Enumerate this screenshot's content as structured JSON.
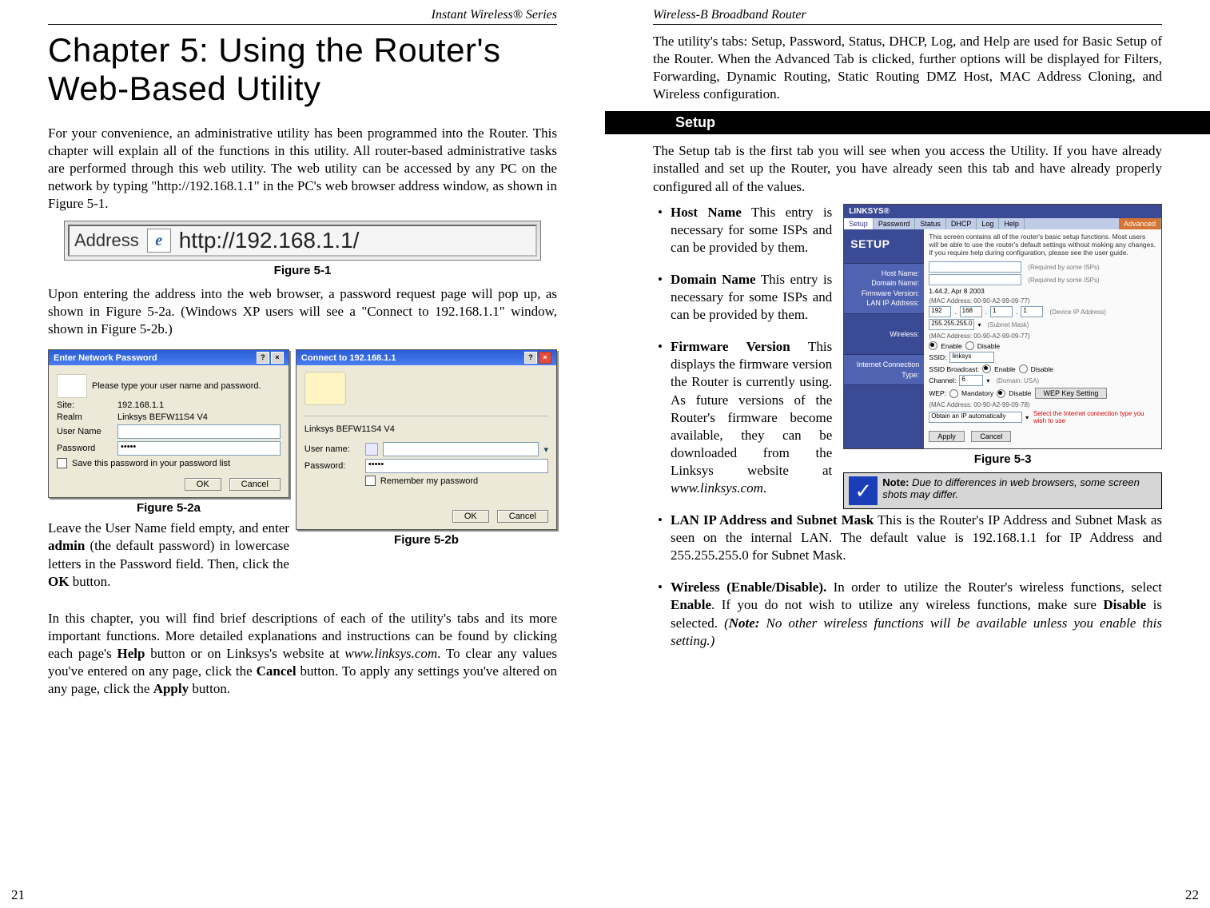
{
  "left": {
    "header": "Instant Wireless® Series",
    "chapter_title": "Chapter 5: Using the Router's Web-Based Utility",
    "p1": "For your convenience, an administrative utility has been programmed into the Router. This chapter will explain all of the functions in this utility. All router-based administrative tasks are performed through this web utility. The web utility can be accessed by any PC on the network by typing \"http://192.168.1.1\" in the PC's web browser address window, as shown in Figure 5-1.",
    "addr_label": "Address",
    "url": "http://192.168.1.1/",
    "fig1": "Figure 5-1",
    "p2": "Upon entering the address into the web browser, a password request page will pop up, as shown in Figure 5-2a. (Windows XP users will see a \"Connect to 192.168.1.1\" window, shown in Figure 5-2b.)",
    "dlgA": {
      "title": "Enter Network Password",
      "help": "?",
      "close": "×",
      "intro": "Please type your user name and password.",
      "site_lbl": "Site:",
      "site_val": "192.168.1.1",
      "realm_lbl": "Realm",
      "realm_val": "Linksys BEFW11S4 V4",
      "user_lbl": "User Name",
      "pass_lbl": "Password",
      "pass_val": "•••••",
      "save_chk": "Save this password in your password list",
      "ok": "OK",
      "cancel": "Cancel"
    },
    "fig2a": "Figure 5-2a",
    "dlgB": {
      "title": "Connect to 192.168.1.1",
      "help": "?",
      "close": "×",
      "realm": "Linksys BEFW11S4 V4",
      "user_lbl": "User name:",
      "pass_lbl": "Password:",
      "pass_val": "•••••",
      "rem": "Remember my password",
      "ok": "OK",
      "cancel": "Cancel"
    },
    "fig2b": "Figure 5-2b",
    "p3a": "Leave the User Name field empty, and enter ",
    "p3b": "admin",
    "p3c": " (the default password) in lowercase letters in the Password field.  Then, click the ",
    "p3d": "OK",
    "p3e": " button.",
    "p4": "In this chapter, you will find brief descriptions of each of the utility's tabs and its more important functions.  More detailed explanations and instructions can be found by clicking each page's Help button or on Linksys's website at www.linksys.com.  To clear any values you've entered on any page, click  the Cancel button.  To apply any settings you've altered on any page, click the Apply button.",
    "pagenum": "21"
  },
  "right": {
    "header": "Wireless-B Broadband Router",
    "p1": "The utility's tabs: Setup, Password, Status, DHCP, Log, and Help are used for Basic Setup of the Router. When the Advanced Tab is clicked, further options will be displayed for Filters, Forwarding, Dynamic Routing, Static Routing DMZ Host, MAC Address Cloning, and Wireless configuration.",
    "section": "Setup",
    "p2": "The Setup tab is the first tab you will see when you access the Utility. If you have already installed and set up the Router, you have already seen this tab and have already properly configured all of the values.",
    "bullets_narrow": [
      {
        "b": "Host Name",
        "t": "  This entry is necessary for some ISPs and can be provided by them."
      },
      {
        "b": "Domain Name",
        "t": "  This entry is necessary for some ISPs and can be provided by them."
      },
      {
        "b": "Firmware Version",
        "t": " This displays the firmware version the Router is currently using. As future versions of the Router's firmware become available, they can be downloaded from the Linksys website at www.linksys.com."
      }
    ],
    "fig3": "Figure 5-3",
    "note_label": "Note:",
    "note_text": "  Due to differences in web browsers, some screen shots may differ.",
    "router": {
      "brand": "LINKSYS®",
      "tabs": [
        "Setup",
        "Password",
        "Status",
        "DHCP",
        "Log",
        "Help"
      ],
      "adv": "Advanced",
      "side_title": "SETUP",
      "side_labels": [
        "Host Name:",
        "Domain Name:",
        "Firmware Version:",
        "LAN IP Address:"
      ],
      "side_wireless": "Wireless:",
      "side_ict": "Internet Connection Type:",
      "desc": "This screen contains all of the router's basic setup functions. Most users will be able to use the router's default settings without making any changes. If you require help during configuration, please see the user guide.",
      "req_hint": "(Required by some ISPs)",
      "fw": "1.44.2, Apr 8 2003",
      "mac1": "(MAC Address: 00-90-A2-99-09-77)",
      "ip": [
        "192",
        "168",
        "1",
        "1"
      ],
      "ip_hint": "(Device IP Address)",
      "mask": "255.255.255.0",
      "mask_hint": "(Subnet Mask)",
      "enable": "Enable",
      "disable": "Disable",
      "mac2": "(MAC Address: 00-90-A2-99-09-77)",
      "ssid_lbl": "SSID:",
      "ssid_val": "linksys",
      "ssidb_lbl": "SSID Broadcast:",
      "chan_lbl": "Channel:",
      "chan_val": "6",
      "chan_hint": "(Domain: USA)",
      "wep_lbl": "WEP:",
      "wep_mandatory": "Mandatory",
      "wep_btn": "WEP Key Setting",
      "mac3": "(MAC Address: 00-90-A2-99-09-78)",
      "ict_val": "Obtain an IP automatically",
      "ict_hint": "Select the Internet connection type you wish to use",
      "apply": "Apply",
      "cancel": "Cancel"
    },
    "bullets_wide": [
      {
        "b": "LAN IP Address and Subnet Mask",
        "t": "  This is the Router's IP Address and Subnet Mask as seen on the internal LAN. The default value is 192.168.1.1 for IP Address and 255.255.255.0 for Subnet Mask."
      },
      {
        "b": "Wireless (Enable/Disable).",
        "t": " In order to utilize the Router's wireless functions, select Enable. If you do not wish to utilize any wireless functions, make sure Disable is selected.  (Note:  No other wireless functions will be available unless you enable this setting.)"
      }
    ],
    "pagenum": "22"
  }
}
